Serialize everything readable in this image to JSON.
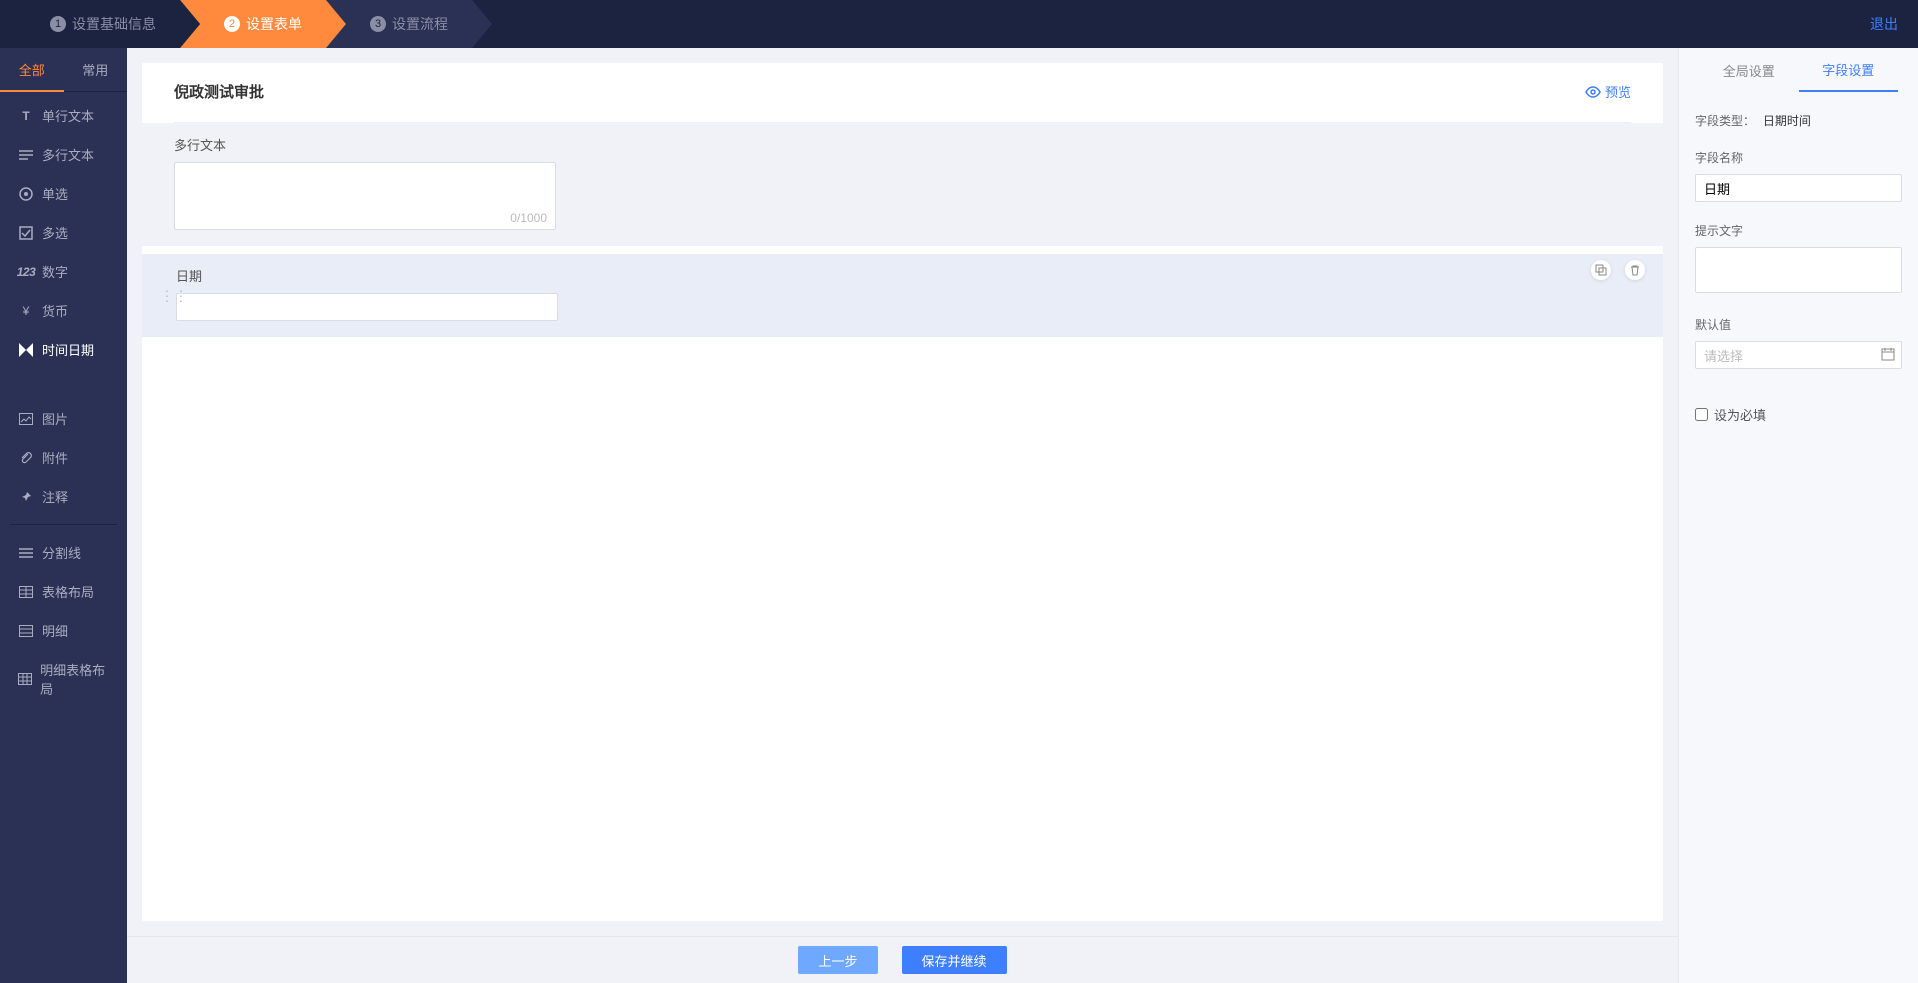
{
  "header": {
    "steps": [
      {
        "num": "1",
        "label": "设置基础信息"
      },
      {
        "num": "2",
        "label": "设置表单"
      },
      {
        "num": "3",
        "label": "设置流程"
      }
    ],
    "exit": "退出"
  },
  "sidebar": {
    "tabs": {
      "all": "全部",
      "common": "常用"
    },
    "group1": [
      {
        "id": "single-text",
        "label": "单行文本",
        "icon": "T"
      },
      {
        "id": "multi-text",
        "label": "多行文本",
        "icon": "≡"
      },
      {
        "id": "radio",
        "label": "单选",
        "icon": "◉"
      },
      {
        "id": "checkbox",
        "label": "多选",
        "icon": "☑"
      },
      {
        "id": "number",
        "label": "数字",
        "icon": "123"
      },
      {
        "id": "currency",
        "label": "货币",
        "icon": "¥"
      },
      {
        "id": "datetime",
        "label": "时间日期",
        "icon": "✉",
        "active": true
      }
    ],
    "group2": [
      {
        "id": "image",
        "label": "图片",
        "icon": "▣"
      },
      {
        "id": "attachment",
        "label": "附件",
        "icon": "📎"
      },
      {
        "id": "note",
        "label": "注释",
        "icon": "📌"
      }
    ],
    "group3": [
      {
        "id": "divider",
        "label": "分割线",
        "icon": "≡"
      },
      {
        "id": "table",
        "label": "表格布局",
        "icon": "▦"
      },
      {
        "id": "detail",
        "label": "明细",
        "icon": "▤"
      },
      {
        "id": "detail-table",
        "label": "明细表格布局",
        "icon": "▦"
      }
    ]
  },
  "canvas": {
    "title": "倪政测试审批",
    "preview": "预览",
    "fields": [
      {
        "type": "textarea",
        "label": "多行文本",
        "counter": "0/1000"
      },
      {
        "type": "date",
        "label": "日期",
        "selected": true
      }
    ]
  },
  "footer": {
    "prev": "上一步",
    "save": "保存并继续"
  },
  "right": {
    "tabs": {
      "global": "全局设置",
      "field": "字段设置"
    },
    "field_type_label": "字段类型：",
    "field_type_value": "日期时间",
    "name_label": "字段名称",
    "name_value": "日期",
    "hint_label": "提示文字",
    "hint_value": "",
    "default_label": "默认值",
    "default_placeholder": "请选择",
    "required_label": "设为必填"
  }
}
